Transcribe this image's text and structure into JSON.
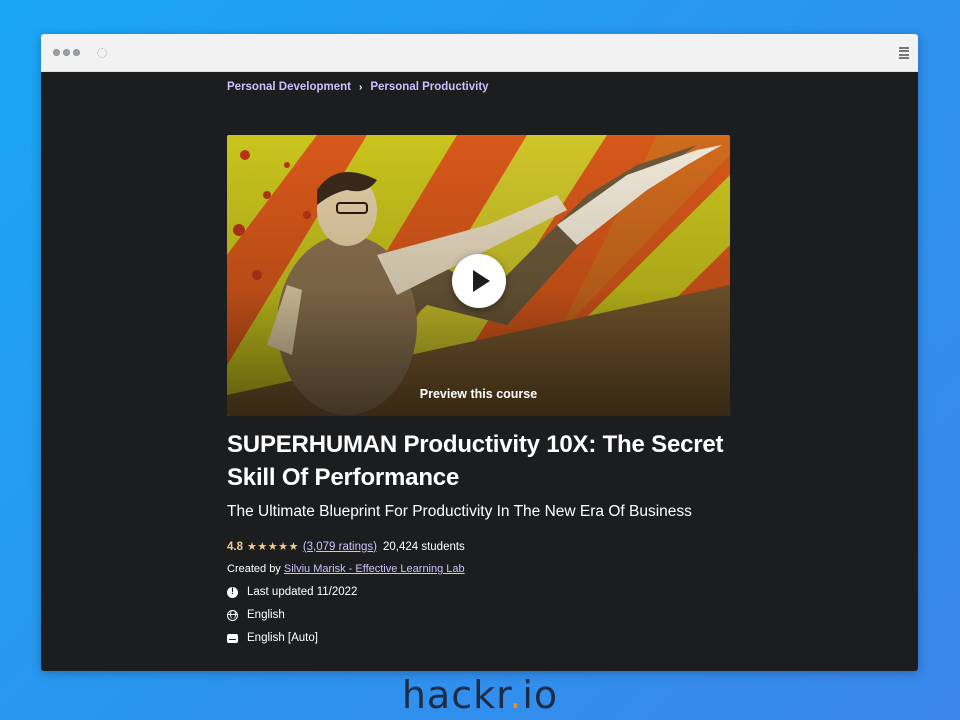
{
  "breadcrumb": {
    "items": [
      "Personal Development",
      "Personal Productivity"
    ],
    "separator": "›"
  },
  "preview": {
    "label": "Preview this course",
    "play_icon": "play-icon"
  },
  "course": {
    "title": "SUPERHUMAN Productivity 10X: The Secret Skill Of Performance",
    "subtitle": "The Ultimate Blueprint For Productivity In The New Era Of Business",
    "rating_value": "4.8",
    "stars": "★★★★★",
    "rating_count": "(3,079 ratings)",
    "students": "20,424 students",
    "created_by_label": "Created by",
    "creator": "Silviu Marisk - Effective Learning Lab",
    "last_updated": "Last updated 11/2022",
    "language": "English",
    "captions": "English [Auto]"
  },
  "brand": {
    "part1": "hackr",
    "dot": ".",
    "part2": "io"
  },
  "colors": {
    "page_background": "#1c1d1f",
    "link_purple": "#cec0fc",
    "star_gold": "#f3ca8c",
    "brand_dark": "#1f2a44",
    "brand_accent": "#f28b19",
    "outer_background": "#2c93ee"
  }
}
